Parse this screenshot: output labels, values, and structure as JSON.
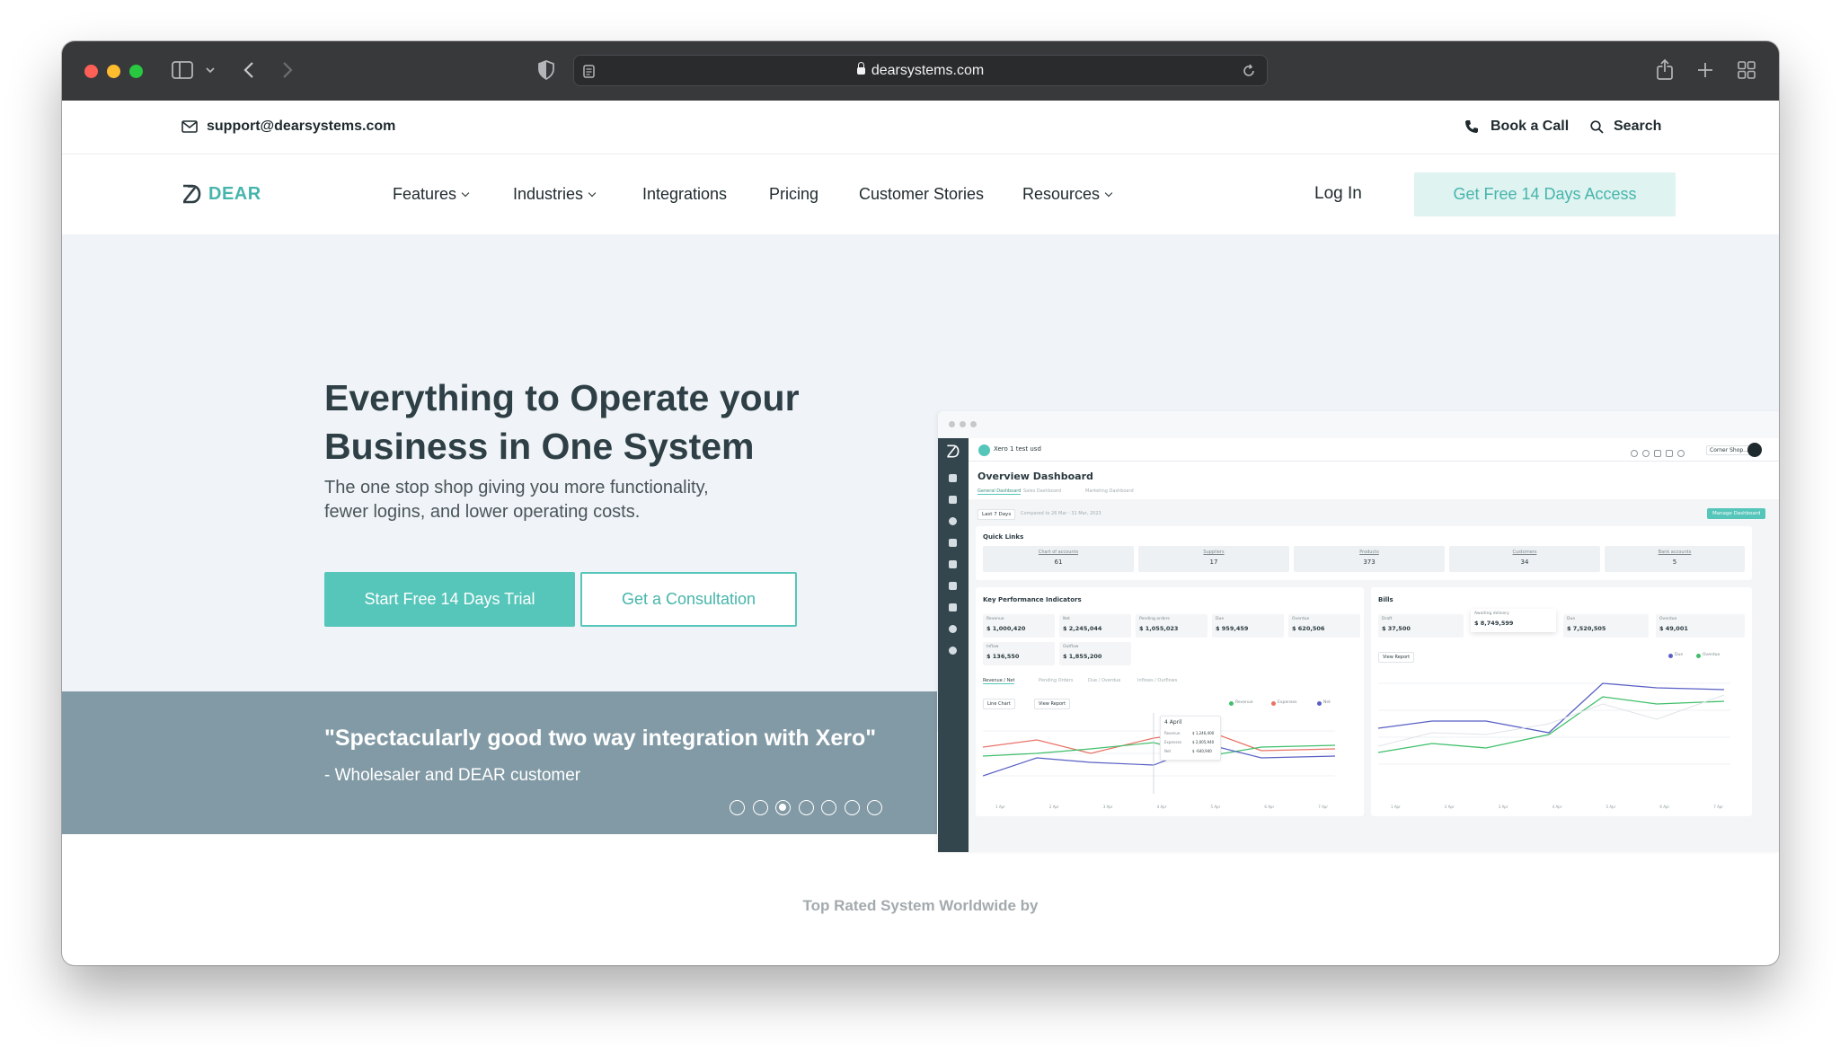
{
  "browser": {
    "url": "dearsystems.com"
  },
  "topbar": {
    "email": "support@dearsystems.com",
    "book_call": "Book a Call",
    "search": "Search"
  },
  "nav": {
    "logo": "DEAR",
    "items": [
      {
        "label": "Features",
        "has_dropdown": true
      },
      {
        "label": "Industries",
        "has_dropdown": true
      },
      {
        "label": "Integrations",
        "has_dropdown": false
      },
      {
        "label": "Pricing",
        "has_dropdown": false
      },
      {
        "label": "Customer Stories",
        "has_dropdown": false
      },
      {
        "label": "Resources",
        "has_dropdown": true
      }
    ],
    "login": "Log In",
    "cta": "Get Free 14 Days Access"
  },
  "hero": {
    "headline_line1": "Everything to Operate your",
    "headline_line2": "Business in One System",
    "subtitle_line1": "The one stop shop giving you more functionality,",
    "subtitle_line2": "fewer logins, and lower operating costs.",
    "primary_button": "Start Free 14 Days Trial",
    "secondary_button": "Get a Consultation"
  },
  "testimonial": {
    "quote": "\"Spectacularly good two way integration with Xero\"",
    "author": "- Wholesaler and DEAR customer",
    "slide_count": 7,
    "active_slide": 3
  },
  "dashboard": {
    "org": "Xero 1 test usd",
    "shop": "Corner Shop...",
    "title": "Overview Dashboard",
    "tabs": [
      "General Dashboard",
      "Sales Dashboard",
      "Marketing Dashboard"
    ],
    "period": "Last 7 Days",
    "compare": "Compared to 26 Mar - 31 Mar, 2023",
    "manage": "Manage Dashboard",
    "quick_links_title": "Quick Links",
    "quick_links": [
      {
        "label": "Chart of accounts",
        "value": "61"
      },
      {
        "label": "Suppliers",
        "value": "17"
      },
      {
        "label": "Products",
        "value": "373"
      },
      {
        "label": "Customers",
        "value": "34"
      },
      {
        "label": "Bank accounts",
        "value": "5"
      }
    ],
    "kpi_title": "Key Performance Indicators",
    "kpis": [
      {
        "label": "Revenue",
        "value": "$ 1,000,420"
      },
      {
        "label": "Net",
        "value": "$ 2,245,044"
      },
      {
        "label": "Pending orders",
        "value": "$ 1,055,023"
      },
      {
        "label": "Due",
        "value": "$ 959,459"
      },
      {
        "label": "Overdue",
        "value": "$ 620,506"
      },
      {
        "label": "Inflow",
        "value": "$ 136,550"
      },
      {
        "label": "Outflow",
        "value": "$ 1,855,200"
      }
    ],
    "kpi_tabs": [
      "Revenue / Net",
      "Pending Orders",
      "Due / Overdue",
      "Inflows / Outflows"
    ],
    "chart_type": "Line Chart",
    "view_report": "View Report",
    "kpi_legend": [
      "Revenue",
      "Expenses",
      "Net"
    ],
    "tooltip_date": "4 April",
    "tooltip_rows": [
      {
        "label": "Revenue",
        "value": "$ 1,246,400"
      },
      {
        "label": "Expenses",
        "value": "$ 2,005,940"
      },
      {
        "label": "Net",
        "value": "$ -640,940"
      }
    ],
    "bills_title": "Bills",
    "bills": [
      {
        "label": "Draft",
        "value": "$ 37,500"
      },
      {
        "label": "Awaiting delivery",
        "value": "$ 8,749,599"
      },
      {
        "label": "Due",
        "value": "$ 7,520,505"
      },
      {
        "label": "Overdue",
        "value": "$ 49,001"
      }
    ],
    "bills_legend": [
      "Due",
      "Overdue"
    ],
    "x_ticks": [
      "1 Apr",
      "2 Apr",
      "3 Apr",
      "4 Apr",
      "5 Apr",
      "6 Apr",
      "7 Apr"
    ]
  },
  "footer": {
    "top_rated": "Top Rated System Worldwide by"
  },
  "colors": {
    "accent": "#56c6ba",
    "accent_text": "#46b5ab",
    "hero_bg": "#f0f4f8",
    "quote_band": "#829aa5",
    "heading": "#2e4046"
  }
}
